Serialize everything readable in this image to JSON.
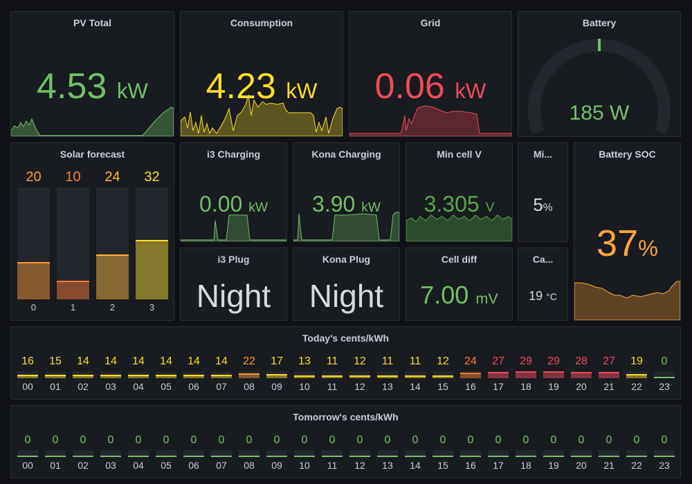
{
  "panels": {
    "pv_total": {
      "title": "PV Total",
      "value": "4.53",
      "unit": "kW",
      "color": "#73bf69"
    },
    "consumption": {
      "title": "Consumption",
      "value": "4.23",
      "unit": "kW",
      "color": "#fade2a"
    },
    "grid": {
      "title": "Grid",
      "value": "0.06",
      "unit": "kW",
      "color": "#f2495c"
    },
    "battery": {
      "title": "Battery",
      "value": "185 W",
      "gauge_fraction": 0.5,
      "color": "#73bf69"
    },
    "solar_forecast": {
      "title": "Solar forecast",
      "max": 60,
      "items": [
        {
          "label": "0",
          "value": "20",
          "num": 20,
          "color": "#ff9830"
        },
        {
          "label": "1",
          "value": "10",
          "num": 10,
          "color": "#ff7a30"
        },
        {
          "label": "2",
          "value": "24",
          "num": 24,
          "color": "#ffb833"
        },
        {
          "label": "3",
          "value": "32",
          "num": 32,
          "color": "#fade2a"
        }
      ]
    },
    "i3_charging": {
      "title": "i3 Charging",
      "value": "0.00",
      "unit": "kW",
      "color": "#73bf69"
    },
    "kona_charging": {
      "title": "Kona Charging",
      "value": "3.90",
      "unit": "kW",
      "color": "#73bf69"
    },
    "min_cell_v": {
      "title": "Min cell V",
      "value": "3.305",
      "unit": "V",
      "color": "#56a64b"
    },
    "mi": {
      "title": "Mi...",
      "value": "5",
      "unit": "%",
      "color": "#d8d9da"
    },
    "battery_soc": {
      "title": "Battery SOC",
      "value": "37",
      "unit": "%",
      "color": "#ffa53d"
    },
    "i3_plug": {
      "title": "i3 Plug",
      "value": "Night",
      "color": "#d8d9da"
    },
    "kona_plug": {
      "title": "Kona Plug",
      "value": "Night",
      "color": "#d8d9da"
    },
    "cell_diff": {
      "title": "Cell diff",
      "value": "7.00",
      "unit": "mV",
      "color": "#73bf69"
    },
    "ca": {
      "title": "Ca...",
      "value": "19",
      "unit": "°C",
      "color": "#d8d9da"
    }
  },
  "prices_today": {
    "title": "Today's cents/kWh",
    "hours": [
      "00",
      "01",
      "02",
      "03",
      "04",
      "05",
      "06",
      "07",
      "08",
      "09",
      "10",
      "11",
      "12",
      "13",
      "14",
      "15",
      "16",
      "17",
      "18",
      "19",
      "20",
      "21",
      "22",
      "23"
    ],
    "values": [
      16,
      15,
      14,
      14,
      14,
      14,
      14,
      14,
      22,
      17,
      13,
      11,
      12,
      11,
      11,
      12,
      24,
      27,
      29,
      29,
      28,
      27,
      19,
      0
    ]
  },
  "prices_tomorrow": {
    "title": "Tomorrow's cents/kWh",
    "hours": [
      "00",
      "01",
      "02",
      "03",
      "04",
      "05",
      "06",
      "07",
      "08",
      "09",
      "10",
      "11",
      "12",
      "13",
      "14",
      "15",
      "16",
      "17",
      "18",
      "19",
      "20",
      "21",
      "22",
      "23"
    ],
    "values": [
      0,
      0,
      0,
      0,
      0,
      0,
      0,
      0,
      0,
      0,
      0,
      0,
      0,
      0,
      0,
      0,
      0,
      0,
      0,
      0,
      0,
      0,
      0,
      0
    ]
  }
}
